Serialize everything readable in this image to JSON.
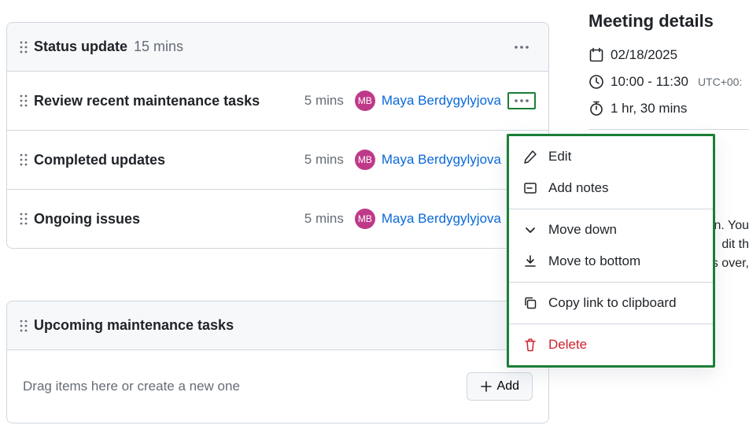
{
  "status": {
    "title": "Status update",
    "duration": "15 mins"
  },
  "items": [
    {
      "title": "Review recent maintenance tasks",
      "duration": "5 mins",
      "presenter": "Maya Berdygylyjova",
      "initials": "MB",
      "kebab_focused": true
    },
    {
      "title": "Completed updates",
      "duration": "5 mins",
      "presenter": "Maya Berdygylyjova",
      "initials": "MB",
      "kebab_focused": false
    },
    {
      "title": "Ongoing issues",
      "duration": "5 mins",
      "presenter": "Maya Berdygylyjova",
      "initials": "MB",
      "kebab_focused": false
    }
  ],
  "upcoming": {
    "title": "Upcoming maintenance tasks",
    "drop_hint": "Drag items here or create a new one",
    "add_label": "Add"
  },
  "details": {
    "heading": "Meeting details",
    "date": "02/18/2025",
    "time_range": "10:00 - 11:30",
    "timezone": "UTC+00:",
    "duration": "1 hr, 30 mins",
    "prose1": "n. You",
    "prose2": "dit th",
    "prose3": "s over,"
  },
  "menu": {
    "edit": "Edit",
    "add_notes": "Add notes",
    "move_down": "Move down",
    "move_bottom": "Move to bottom",
    "copy_link": "Copy link to clipboard",
    "delete": "Delete"
  }
}
